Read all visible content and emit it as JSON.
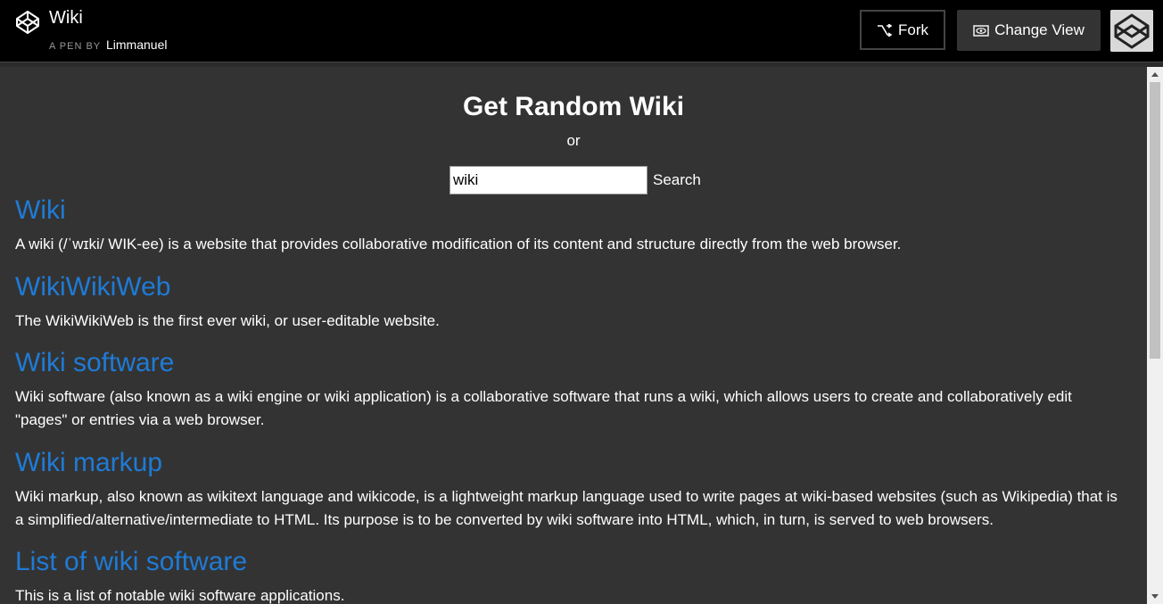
{
  "header": {
    "title": "Wiki",
    "by_label": "A PEN BY",
    "author": "Limmanuel",
    "fork_label": "Fork",
    "change_view_label": "Change View"
  },
  "main": {
    "heading": "Get Random Wiki",
    "or_text": "or",
    "search_value": "wiki",
    "search_button": "Search"
  },
  "results": [
    {
      "title": "Wiki",
      "description": "A wiki (/ˈwɪki/ WIK-ee) is a website that provides collaborative modification of its content and structure directly from the web browser."
    },
    {
      "title": "WikiWikiWeb",
      "description": "The WikiWikiWeb is the first ever wiki, or user-editable website."
    },
    {
      "title": "Wiki software",
      "description": "Wiki software (also known as a wiki engine or wiki application) is a collaborative software that runs a wiki, which allows users to create and collaboratively edit \"pages\" or entries via a web browser."
    },
    {
      "title": "Wiki markup",
      "description": "Wiki markup, also known as wikitext language and wikicode, is a lightweight markup language used to write pages at wiki-based websites (such as Wikipedia) that is a simplified/alternative/intermediate to HTML. Its purpose is to be converted by wiki software into HTML, which, in turn, is served to web browsers."
    },
    {
      "title": "List of wiki software",
      "description": "This is a list of notable wiki software applications."
    }
  ],
  "colors": {
    "background": "#333333",
    "header": "#000000",
    "link": "#1f7bd6"
  }
}
